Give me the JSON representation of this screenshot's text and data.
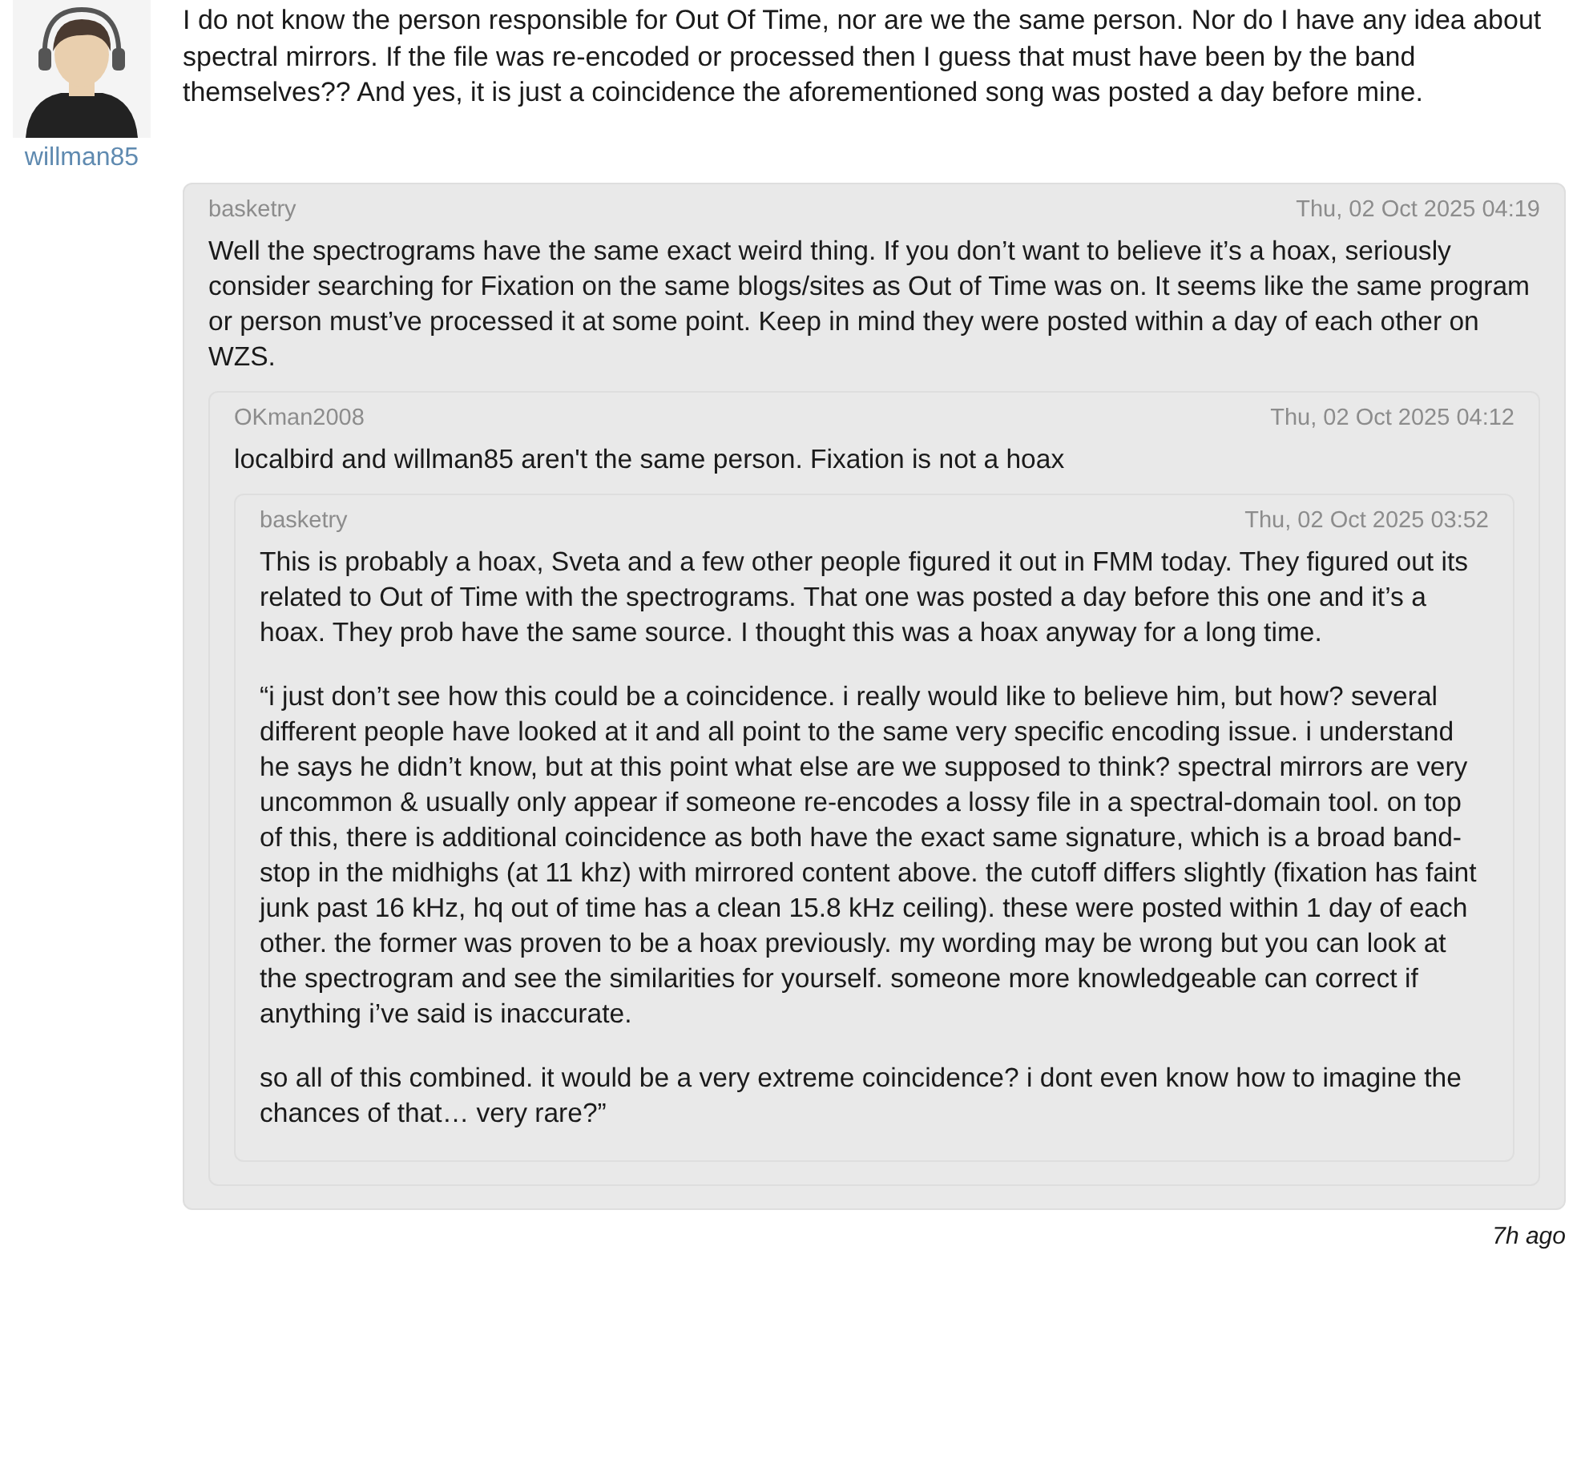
{
  "post": {
    "author": "willman85",
    "text": "I do not know the person responsible for Out Of Time, nor are we the same person. Nor do I have any idea about spectral mirrors. If the file was re-encoded or processed then I guess that must have been by the band themselves?? And yes, it is just a coincidence the aforementioned song was posted a day before mine.",
    "time": "7h ago",
    "quote": {
      "author": "basketry",
      "date": "Thu, 02 Oct 2025 04:19",
      "paragraphs": [
        "Well the spectrograms have the same exact weird thing. If you don’t want to believe it’s a hoax, seriously consider searching for Fixation on the same blogs/sites as Out of Time was on. It seems like the same program or person must’ve processed it at some point. Keep in mind they were posted within a day of each other on WZS."
      ],
      "quote": {
        "author": "OKman2008",
        "date": "Thu, 02 Oct 2025 04:12",
        "paragraphs": [
          "localbird and willman85 aren't the same person. Fixation is not a hoax"
        ],
        "quote": {
          "author": "basketry",
          "date": "Thu, 02 Oct 2025 03:52",
          "paragraphs": [
            "This is probably a hoax, Sveta and a few other people figured it out in FMM today. They figured out its related to Out of Time with the spectrograms. That one was posted a day before this one and it’s a hoax. They prob have the same source. I thought this was a hoax anyway for a long time.",
            "“i just don’t see how this could be a coincidence. i really would like to believe him, but how? several different people have looked at it and all point to the same very specific encoding issue. i understand he says he didn’t know, but at this point what else are we supposed to think? spectral mirrors are very uncommon & usually only appear if someone re-encodes a lossy file in a spectral-domain tool. on top of this, there is additional coincidence as both have the exact same signature, which is a broad band-stop in the midhighs (at 11 khz) with mirrored content above. the cutoff differs slightly (fixation has faint junk past 16 kHz, hq out of time has a clean 15.8 kHz ceiling). these were posted within 1 day of each other. the former was proven to be a hoax previously. my wording may be wrong but you can look at the spectrogram and see the similarities for yourself. someone more knowledgeable can correct if anything i’ve said is inaccurate.",
            "so all of this combined. it would be a very extreme coincidence? i dont even know how to imagine the chances of that… very rare?”"
          ]
        }
      }
    }
  }
}
